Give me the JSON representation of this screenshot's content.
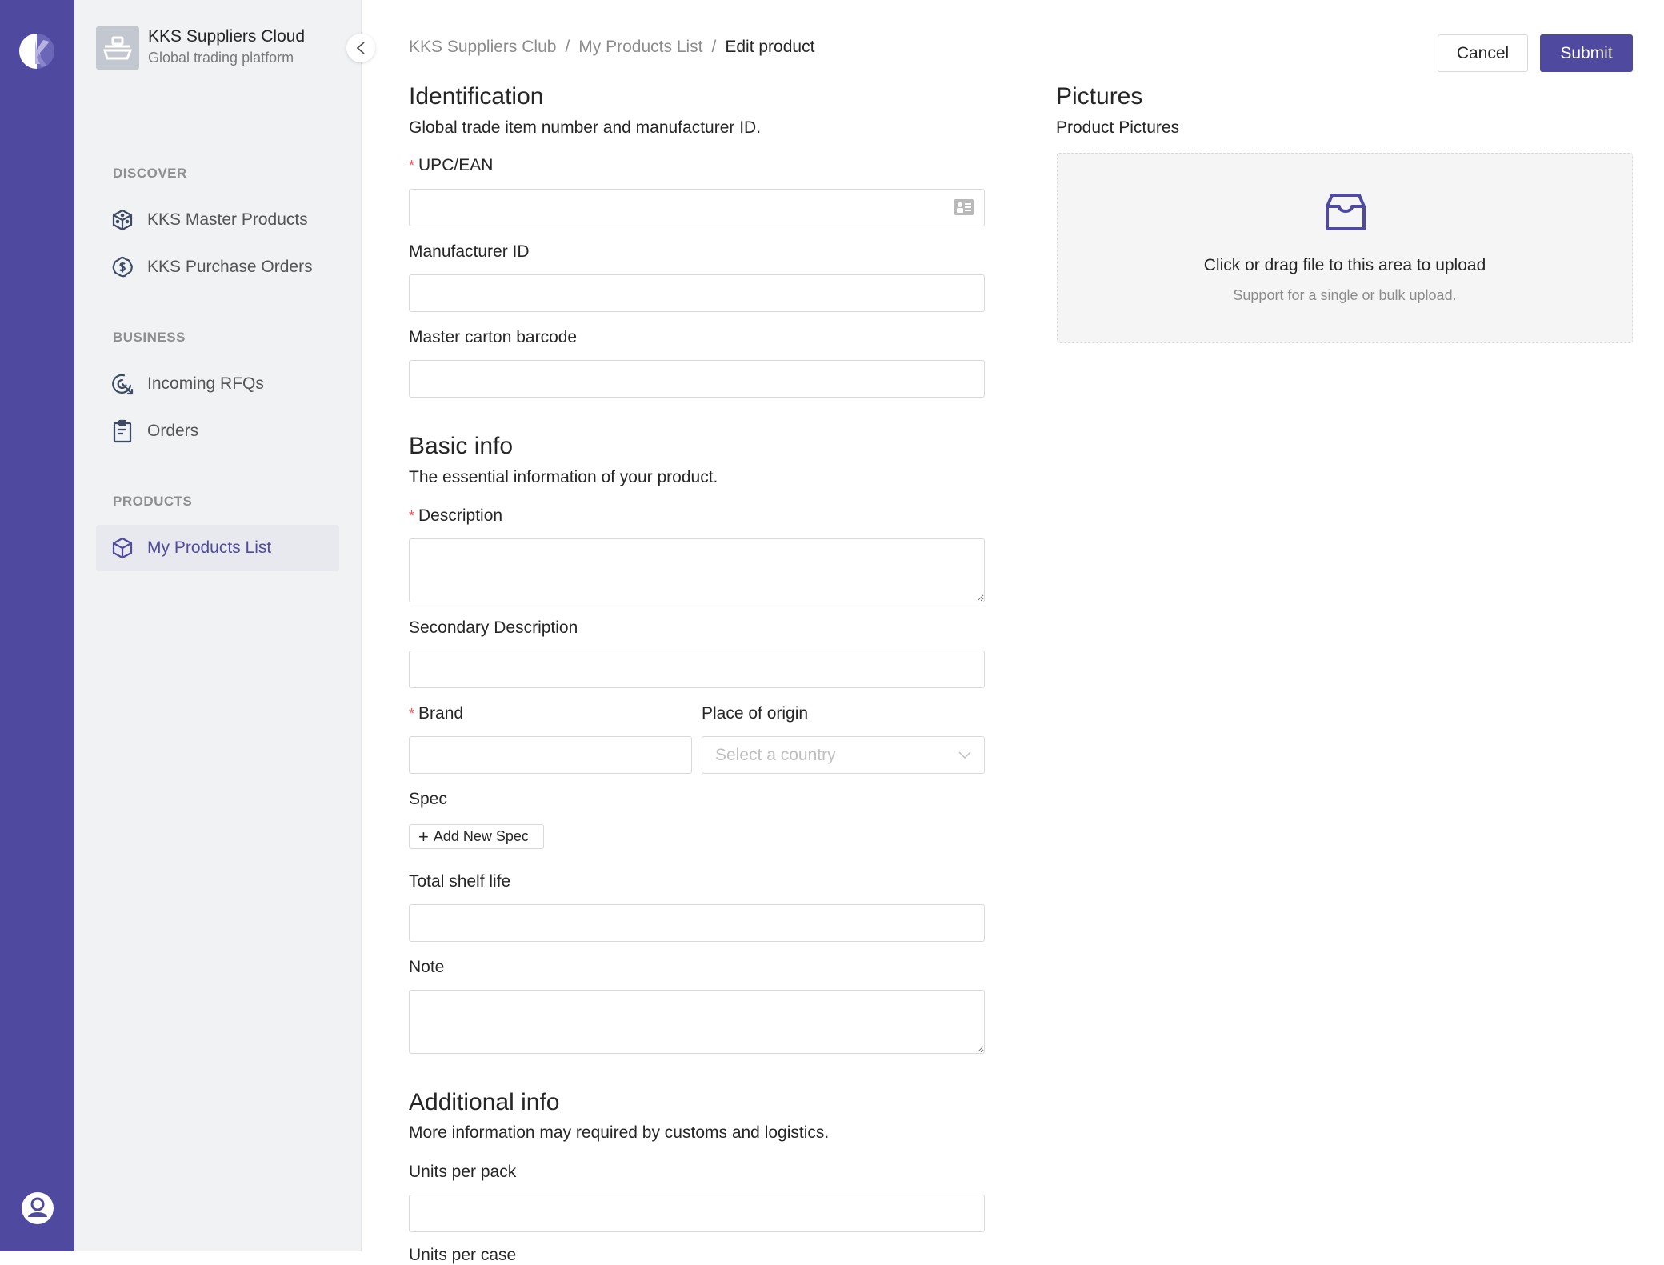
{
  "app": {
    "title": "KKS Suppliers Cloud",
    "subtitle": "Global trading platform",
    "accent_color": "#4f4aa0"
  },
  "sidebar": {
    "sections": [
      {
        "label": "DISCOVER",
        "items": [
          {
            "label": "KKS Master Products",
            "icon": "box-icon",
            "active": false
          },
          {
            "label": "KKS Purchase Orders",
            "icon": "dollar-badge-icon",
            "active": false
          }
        ]
      },
      {
        "label": "BUSINESS",
        "items": [
          {
            "label": "Incoming RFQs",
            "icon": "target-icon",
            "active": false
          },
          {
            "label": "Orders",
            "icon": "clipboard-icon",
            "active": false
          }
        ]
      },
      {
        "label": "PRODUCTS",
        "items": [
          {
            "label": "My Products List",
            "icon": "cube-icon",
            "active": true
          }
        ]
      }
    ]
  },
  "breadcrumb": {
    "items": [
      "KKS Suppliers Club",
      "My Products List",
      "Edit product"
    ],
    "separator": "/"
  },
  "actions": {
    "cancel_label": "Cancel",
    "submit_label": "Submit"
  },
  "identification": {
    "title": "Identification",
    "description": "Global trade item number and manufacturer ID.",
    "fields": {
      "upc": {
        "label": "UPC/EAN",
        "required": true,
        "value": ""
      },
      "manufacturer_id": {
        "label": "Manufacturer ID",
        "required": false,
        "value": ""
      },
      "master_carton": {
        "label": "Master carton barcode",
        "required": false,
        "value": ""
      }
    }
  },
  "basic_info": {
    "title": "Basic info",
    "description": "The essential information of your product.",
    "fields": {
      "description": {
        "label": "Description",
        "required": true,
        "value": ""
      },
      "secondary_description": {
        "label": "Secondary Description",
        "required": false,
        "value": ""
      },
      "brand": {
        "label": "Brand",
        "required": true,
        "value": ""
      },
      "place_of_origin": {
        "label": "Place of origin",
        "placeholder": "Select a country",
        "value": ""
      },
      "spec": {
        "label": "Spec",
        "add_button": "Add New Spec"
      },
      "total_shelf_life": {
        "label": "Total shelf life",
        "value": ""
      },
      "note": {
        "label": "Note",
        "value": ""
      }
    }
  },
  "additional_info": {
    "title": "Additional info",
    "description": "More information may required by customs and logistics.",
    "fields": {
      "units_per_pack": {
        "label": "Units per pack",
        "value": ""
      },
      "units_per_case": {
        "label": "Units per case"
      }
    }
  },
  "pictures": {
    "title": "Pictures",
    "subtitle": "Product Pictures",
    "upload_text": "Click or drag file to this area to upload",
    "upload_hint": "Support for a single or bulk upload."
  }
}
